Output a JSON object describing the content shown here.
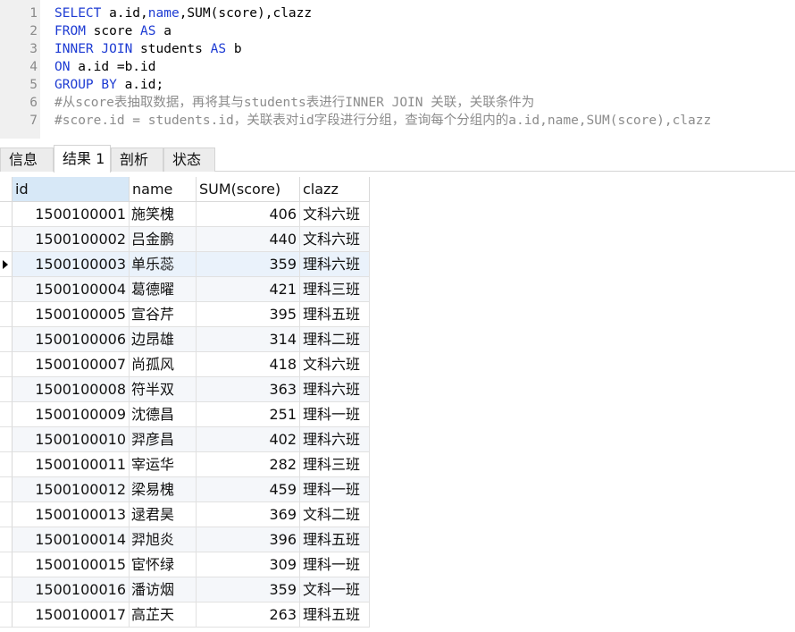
{
  "editor": {
    "lines": [
      {
        "num": "1",
        "parts": [
          [
            "kw",
            "SELECT"
          ],
          [
            "t",
            " a.id,"
          ],
          [
            "kw",
            "name"
          ],
          [
            "t",
            ",SUM(score),clazz"
          ]
        ]
      },
      {
        "num": "2",
        "parts": [
          [
            "kw",
            "FROM"
          ],
          [
            "t",
            " score "
          ],
          [
            "kw",
            "AS"
          ],
          [
            "t",
            " a"
          ]
        ]
      },
      {
        "num": "3",
        "parts": [
          [
            "kw",
            "INNER JOIN"
          ],
          [
            "t",
            " students "
          ],
          [
            "kw",
            "AS"
          ],
          [
            "t",
            " b"
          ]
        ]
      },
      {
        "num": "4",
        "parts": [
          [
            "kw",
            "ON"
          ],
          [
            "t",
            " a.id =b.id"
          ]
        ]
      },
      {
        "num": "5",
        "parts": [
          [
            "kw",
            "GROUP BY"
          ],
          [
            "t",
            " a.id;"
          ]
        ]
      },
      {
        "num": "6",
        "parts": [
          [
            "cm",
            "#从score表抽取数据，再将其与students表进行INNER JOIN 关联，关联条件为"
          ]
        ]
      },
      {
        "num": "7",
        "parts": [
          [
            "cm",
            "#score.id = students.id，关联表对id字段进行分组，查询每个分组内的a.id,name,SUM(score),clazz"
          ]
        ]
      }
    ]
  },
  "tabs": [
    {
      "label": "信息",
      "active": false
    },
    {
      "label": "结果 1",
      "active": true
    },
    {
      "label": "剖析",
      "active": false
    },
    {
      "label": "状态",
      "active": false
    }
  ],
  "grid": {
    "columns": [
      "id",
      "name",
      "SUM(score)",
      "clazz"
    ],
    "current_row": 2,
    "rows": [
      [
        "1500100001",
        "施笑槐",
        "406",
        "文科六班"
      ],
      [
        "1500100002",
        "吕金鹏",
        "440",
        "文科六班"
      ],
      [
        "1500100003",
        "单乐蕊",
        "359",
        "理科六班"
      ],
      [
        "1500100004",
        "葛德曜",
        "421",
        "理科三班"
      ],
      [
        "1500100005",
        "宣谷芹",
        "395",
        "理科五班"
      ],
      [
        "1500100006",
        "边昂雄",
        "314",
        "理科二班"
      ],
      [
        "1500100007",
        "尚孤风",
        "418",
        "文科六班"
      ],
      [
        "1500100008",
        "符半双",
        "363",
        "理科六班"
      ],
      [
        "1500100009",
        "沈德昌",
        "251",
        "理科一班"
      ],
      [
        "1500100010",
        "羿彦昌",
        "402",
        "理科六班"
      ],
      [
        "1500100011",
        "宰运华",
        "282",
        "理科三班"
      ],
      [
        "1500100012",
        "梁易槐",
        "459",
        "理科一班"
      ],
      [
        "1500100013",
        "逯君昊",
        "369",
        "文科二班"
      ],
      [
        "1500100014",
        "羿旭炎",
        "396",
        "理科五班"
      ],
      [
        "1500100015",
        "宦怀绿",
        "309",
        "理科一班"
      ],
      [
        "1500100016",
        "潘访烟",
        "359",
        "文科一班"
      ],
      [
        "1500100017",
        "高芷天",
        "263",
        "理科五班"
      ]
    ]
  }
}
